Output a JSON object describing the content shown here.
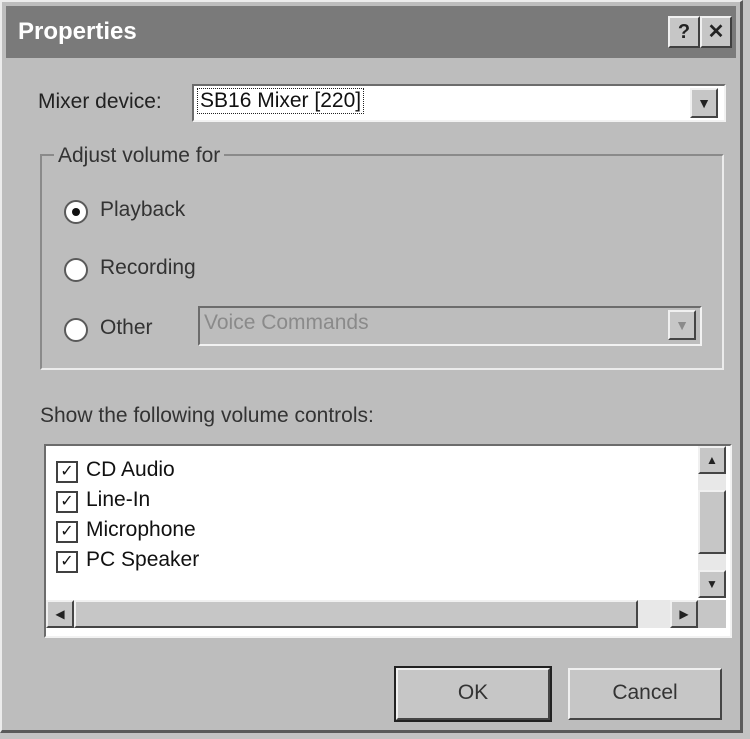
{
  "window": {
    "title": "Properties",
    "help_button": "?",
    "close_button": "✕"
  },
  "mixer": {
    "label": "Mixer device:",
    "value": "SB16 Mixer [220]",
    "arrow_icon": "chevron-down-icon"
  },
  "adjust": {
    "group_label": "Adjust volume for",
    "options": [
      {
        "label": "Playback",
        "selected": true
      },
      {
        "label": "Recording",
        "selected": false
      },
      {
        "label": "Other",
        "selected": false
      }
    ],
    "other_value": "Voice Commands"
  },
  "controls": {
    "label": "Show the following volume controls:",
    "items": [
      {
        "label": "CD Audio",
        "checked": true
      },
      {
        "label": "Line-In",
        "checked": true
      },
      {
        "label": "Microphone",
        "checked": true
      },
      {
        "label": "PC Speaker",
        "checked": true
      }
    ]
  },
  "buttons": {
    "ok": "OK",
    "cancel": "Cancel"
  }
}
